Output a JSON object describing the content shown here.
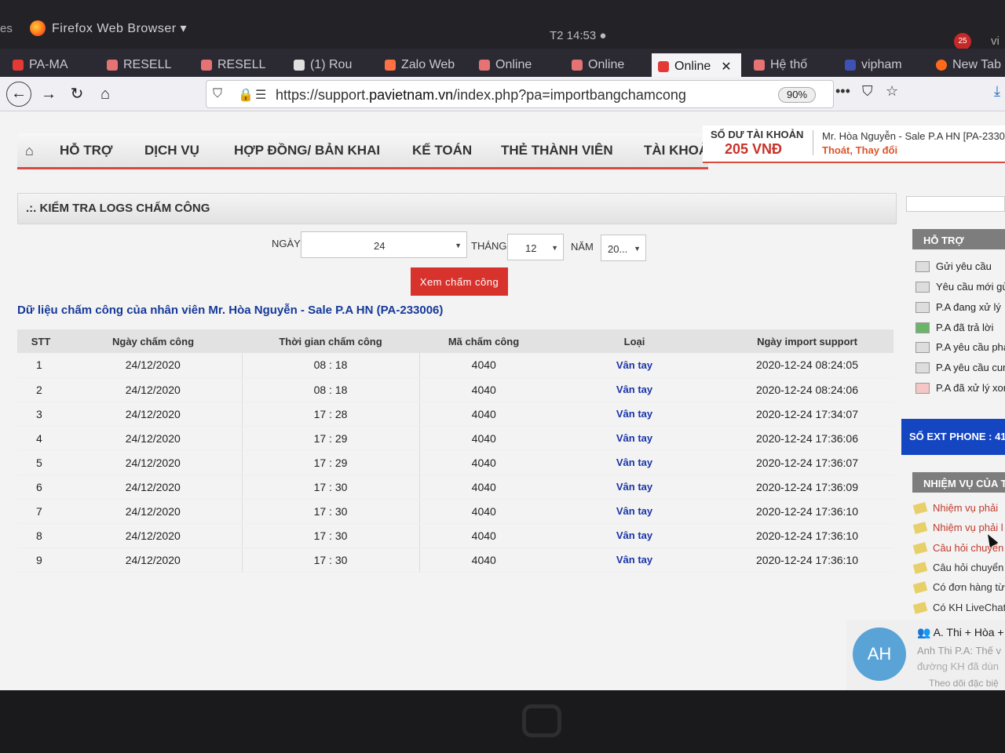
{
  "os": {
    "activities": "es",
    "app_name": "Firefox Web Browser ▾",
    "clock": "T2 14:53 ●",
    "tray_badge": "25",
    "user": "vi"
  },
  "tabs": [
    {
      "label": "PA-MA",
      "color": "#e53935"
    },
    {
      "label": "RESELL",
      "color": "#e57373"
    },
    {
      "label": "RESELL",
      "color": "#e57373"
    },
    {
      "label": "(1) Rou",
      "color": "#e0e0e0"
    },
    {
      "label": "Zalo Web",
      "color": "#ff7043"
    },
    {
      "label": "Online",
      "color": "#e57373"
    },
    {
      "label": "Online",
      "color": "#e57373"
    },
    {
      "label": "Online",
      "color": "#e53935"
    },
    {
      "label": "Hệ thố",
      "color": "#e57373"
    },
    {
      "label": "vipham",
      "color": "#3f51b5"
    },
    {
      "label": "New Tab",
      "color": "#ff6a19"
    }
  ],
  "nav": {
    "url_prefix": "https://support.",
    "url_domain": "pavietnam.vn",
    "url_suffix": "/index.php?pa=importbangchamcong",
    "zoom": "90%"
  },
  "menu": {
    "items": [
      "HỖ TRỢ",
      "DỊCH VỤ",
      "HỢP ĐỒNG/ BẢN KHAI",
      "KẾ TOÁN",
      "THẺ THÀNH VIÊN",
      "TÀI KHOẢ"
    ]
  },
  "account": {
    "balance_label": "SỐ DƯ TÀI KHOẢN",
    "balance_value": "205 VNĐ",
    "name": "Mr. Hòa Nguyễn - Sale P.A HN [PA-2330",
    "logout": "Thoát,",
    "change": "Thay đổi"
  },
  "section": {
    "title": ".:. KIỂM TRA LOGS CHẤM CÔNG"
  },
  "filter": {
    "day_label": "NGÀY",
    "day_value": "24",
    "month_label": "THÁNG",
    "month_value": "12",
    "year_label": "NĂM",
    "year_value": "20...",
    "view_button": "Xem chấm công"
  },
  "data_title": "Dữ liệu chấm công của nhân viên Mr. Hòa Nguyễn - Sale P.A HN (PA-233006)",
  "table": {
    "headers": [
      "STT",
      "Ngày chấm công",
      "Thời gian chấm công",
      "Mã chấm công",
      "Loại",
      "Ngày import support"
    ],
    "rows": [
      [
        "1",
        "24/12/2020",
        "08 : 18",
        "4040",
        "Vân tay",
        "2020-12-24 08:24:05"
      ],
      [
        "2",
        "24/12/2020",
        "08 : 18",
        "4040",
        "Vân tay",
        "2020-12-24 08:24:06"
      ],
      [
        "3",
        "24/12/2020",
        "17 : 28",
        "4040",
        "Vân tay",
        "2020-12-24 17:34:07"
      ],
      [
        "4",
        "24/12/2020",
        "17 : 29",
        "4040",
        "Vân tay",
        "2020-12-24 17:36:06"
      ],
      [
        "5",
        "24/12/2020",
        "17 : 29",
        "4040",
        "Vân tay",
        "2020-12-24 17:36:07"
      ],
      [
        "6",
        "24/12/2020",
        "17 : 30",
        "4040",
        "Vân tay",
        "2020-12-24 17:36:09"
      ],
      [
        "7",
        "24/12/2020",
        "17 : 30",
        "4040",
        "Vân tay",
        "2020-12-24 17:36:10"
      ],
      [
        "8",
        "24/12/2020",
        "17 : 30",
        "4040",
        "Vân tay",
        "2020-12-24 17:36:10"
      ],
      [
        "9",
        "24/12/2020",
        "17 : 30",
        "4040",
        "Vân tay",
        "2020-12-24 17:36:10"
      ]
    ]
  },
  "sidebar": {
    "support_head": "HỖ TRỢ",
    "support_items": [
      "Gửi yêu cầu",
      "Yêu cầu mới gử",
      "P.A đang xử lý",
      "P.A đã trả lời",
      "P.A yêu cầu phả",
      "P.A yêu cầu cun",
      "P.A đã xử lý xon"
    ],
    "ext_phone": "SỐ EXT PHONE : 41",
    "task_head": "NHIỆM VỤ CỦA T",
    "task_items": [
      "Nhiệm vụ phải",
      "Nhiệm vụ phải l",
      "Câu hỏi chuyển",
      "Câu hỏi chuyển",
      "Có đơn hàng từ",
      "Có KH LiveChat"
    ]
  },
  "chat": {
    "avatar": "AH",
    "title": "A. Thi + Hòa +",
    "msg1": "Anh Thi P.A: Thế v",
    "msg2": "đường KH đã dùn",
    "msg3": "Theo dõi đặc biệ"
  }
}
